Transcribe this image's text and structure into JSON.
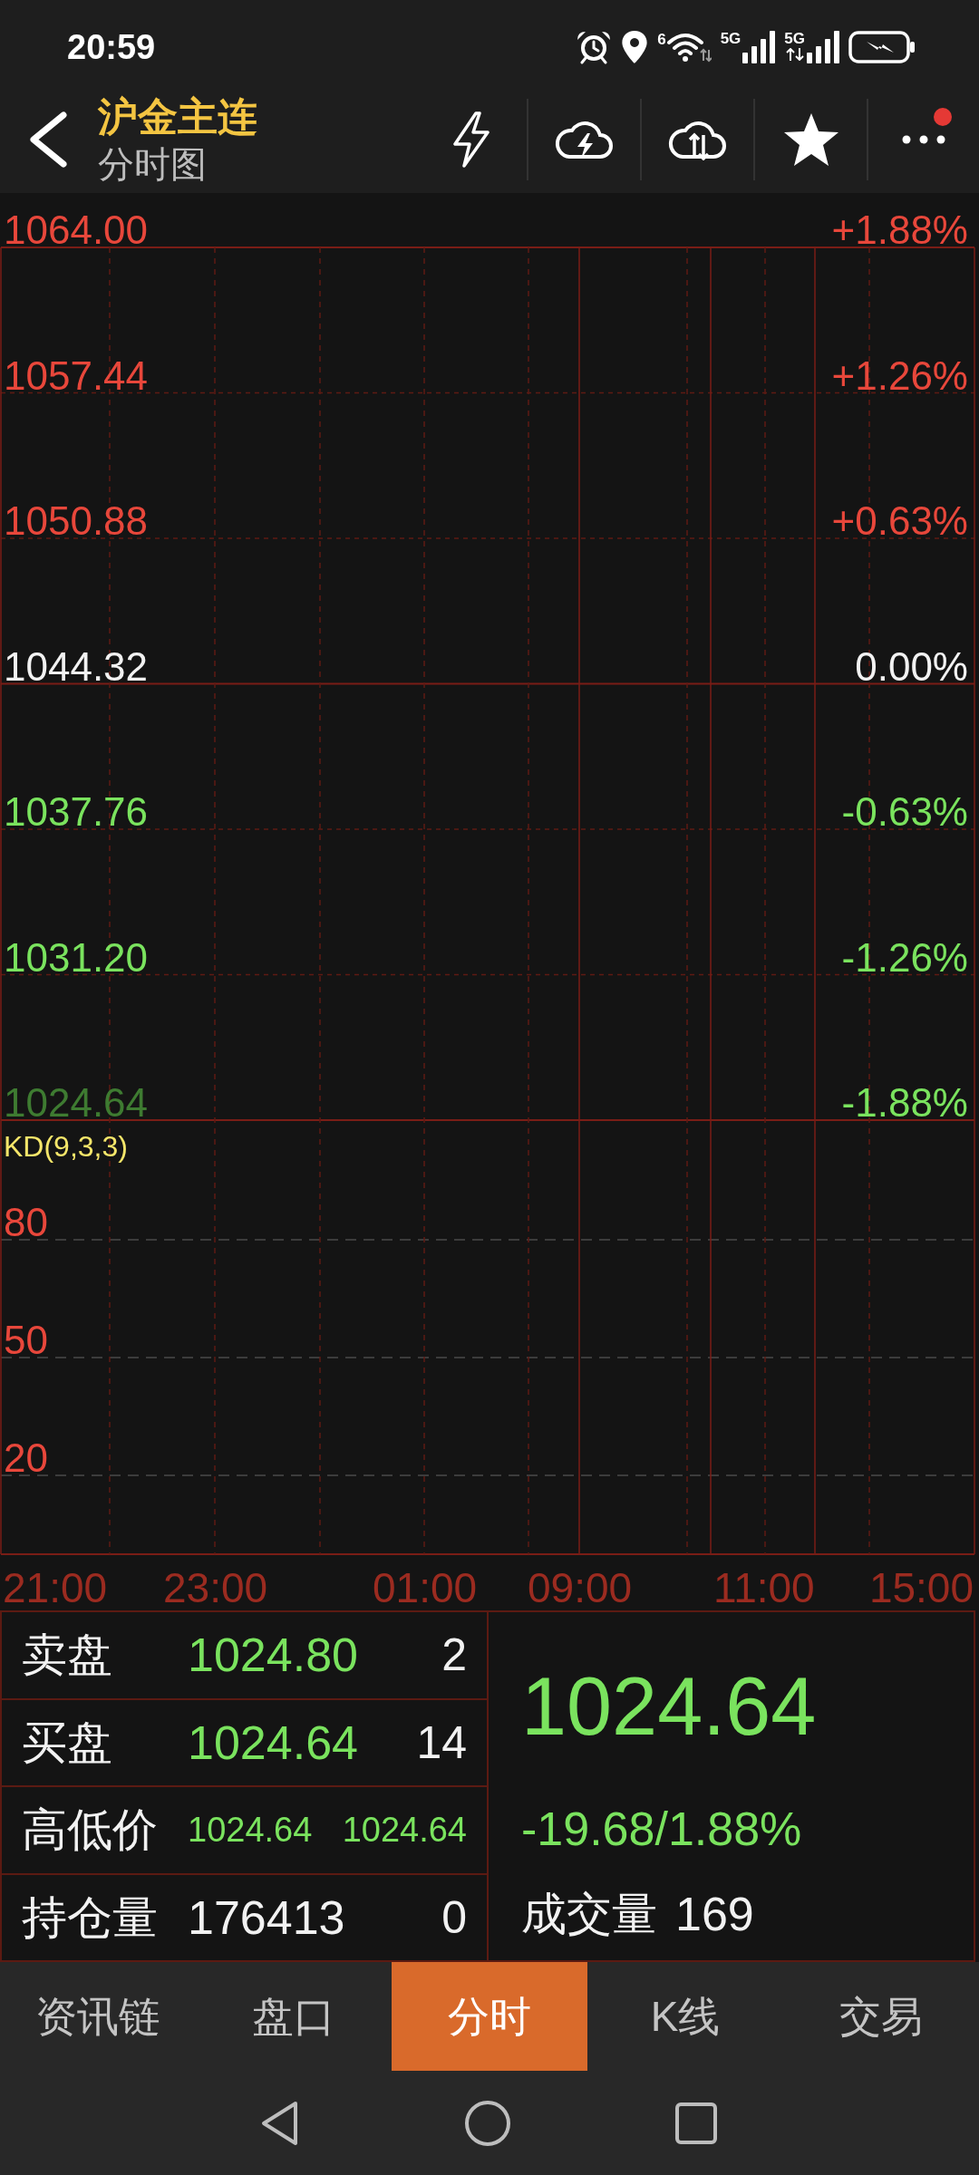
{
  "status_bar": {
    "time": "20:59",
    "wifi_label": "6",
    "networks": [
      {
        "label": "5G",
        "data_active": false
      },
      {
        "label": "5G",
        "data_active": true
      }
    ]
  },
  "header": {
    "title": "沪金主连",
    "subtitle": "分时图",
    "more_badge": true
  },
  "price_axis": [
    {
      "price": {
        "text": "1064.00",
        "color": "#e8473b"
      },
      "change": {
        "text": "+1.88%",
        "color": "#e8473b"
      }
    },
    {
      "price": {
        "text": "1057.44",
        "color": "#e8473b"
      },
      "change": {
        "text": "+1.26%",
        "color": "#e8473b"
      }
    },
    {
      "price": {
        "text": "1050.88",
        "color": "#e8473b"
      },
      "change": {
        "text": "+0.63%",
        "color": "#e8473b"
      }
    },
    {
      "price": {
        "text": "1044.32",
        "color": "#f2f2f2"
      },
      "change": {
        "text": "0.00%",
        "color": "#f2f2f2"
      }
    },
    {
      "price": {
        "text": "1037.76",
        "color": "#7ae35e"
      },
      "change": {
        "text": "-0.63%",
        "color": "#7ae35e"
      }
    },
    {
      "price": {
        "text": "1031.20",
        "color": "#7ae35e"
      },
      "change": {
        "text": "-1.26%",
        "color": "#7ae35e"
      }
    },
    {
      "price": {
        "text": "1024.64",
        "color": "#3e7b31"
      },
      "change": {
        "text": "-1.88%",
        "color": "#7ae35e"
      }
    }
  ],
  "kd_panel": {
    "title": "KD(9,3,3)",
    "levels": [
      "80",
      "50",
      "20"
    ]
  },
  "time_axis": [
    "21:00",
    "23:00",
    "01:00",
    "09:00",
    "11:00",
    "15:00"
  ],
  "quote": {
    "rows": [
      {
        "kind": "quote",
        "label": "卖盘",
        "price": "1024.80",
        "volume": "2"
      },
      {
        "kind": "quote",
        "label": "买盘",
        "price": "1024.64",
        "volume": "14"
      },
      {
        "kind": "range",
        "label": "高低价",
        "high": "1024.64",
        "low": "1024.64"
      },
      {
        "kind": "stat",
        "label": "持仓量",
        "value": "176413",
        "change": "0"
      }
    ],
    "last_price": "1024.64",
    "change": "-19.68/1.88%",
    "volume": {
      "label": "成交量",
      "value": "169"
    }
  },
  "tabs": [
    {
      "label": "资讯链",
      "selected": false
    },
    {
      "label": "盘口",
      "selected": false
    },
    {
      "label": "分时",
      "selected": true
    },
    {
      "label": "K线",
      "selected": false
    },
    {
      "label": "交易",
      "selected": false
    }
  ]
}
